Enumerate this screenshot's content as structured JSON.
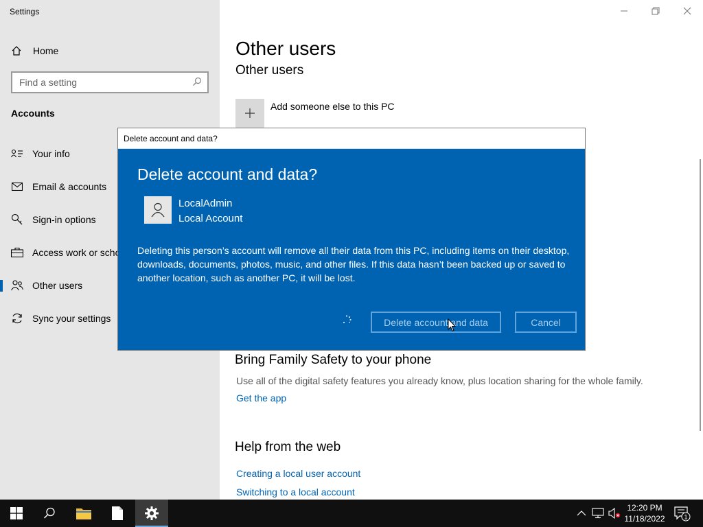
{
  "window": {
    "title": "Settings"
  },
  "sidebar": {
    "home_label": "Home",
    "search_placeholder": "Find a setting",
    "section": "Accounts",
    "items": [
      {
        "label": "Your info",
        "icon": "person-card-icon"
      },
      {
        "label": "Email & accounts",
        "icon": "mail-icon"
      },
      {
        "label": "Sign-in options",
        "icon": "key-icon"
      },
      {
        "label": "Access work or scho",
        "icon": "briefcase-icon"
      },
      {
        "label": "Other users",
        "icon": "people-icon",
        "active": true
      },
      {
        "label": "Sync your settings",
        "icon": "sync-icon"
      }
    ]
  },
  "main": {
    "title": "Other users",
    "subtitle": "Other users",
    "add_label": "Add someone else to this PC",
    "family_title": "Bring Family Safety to your phone",
    "family_desc": "Use all of the digital safety features you already know, plus location sharing for the whole family.",
    "get_app": "Get the app",
    "help_title": "Help from the web",
    "help_links": [
      "Creating a local user account",
      "Switching to a local account"
    ]
  },
  "dialog": {
    "window_title": "Delete account and data?",
    "heading": "Delete account and data?",
    "account_name": "LocalAdmin",
    "account_type": "Local Account",
    "message": "Deleting this person’s account will remove all their data from this PC, including items on their desktop, downloads, documents, photos, music, and other files. If this data hasn’t been backed up or saved to another location, such as another PC, it will be lost.",
    "delete_label": "Delete account and data",
    "cancel_label": "Cancel"
  },
  "taskbar": {
    "time": "12:20 PM",
    "date": "11/18/2022",
    "notification_count": "1"
  },
  "colors": {
    "accent": "#0063b1",
    "sidebar_bg": "#e6e6e6",
    "taskbar_bg": "#101010"
  }
}
